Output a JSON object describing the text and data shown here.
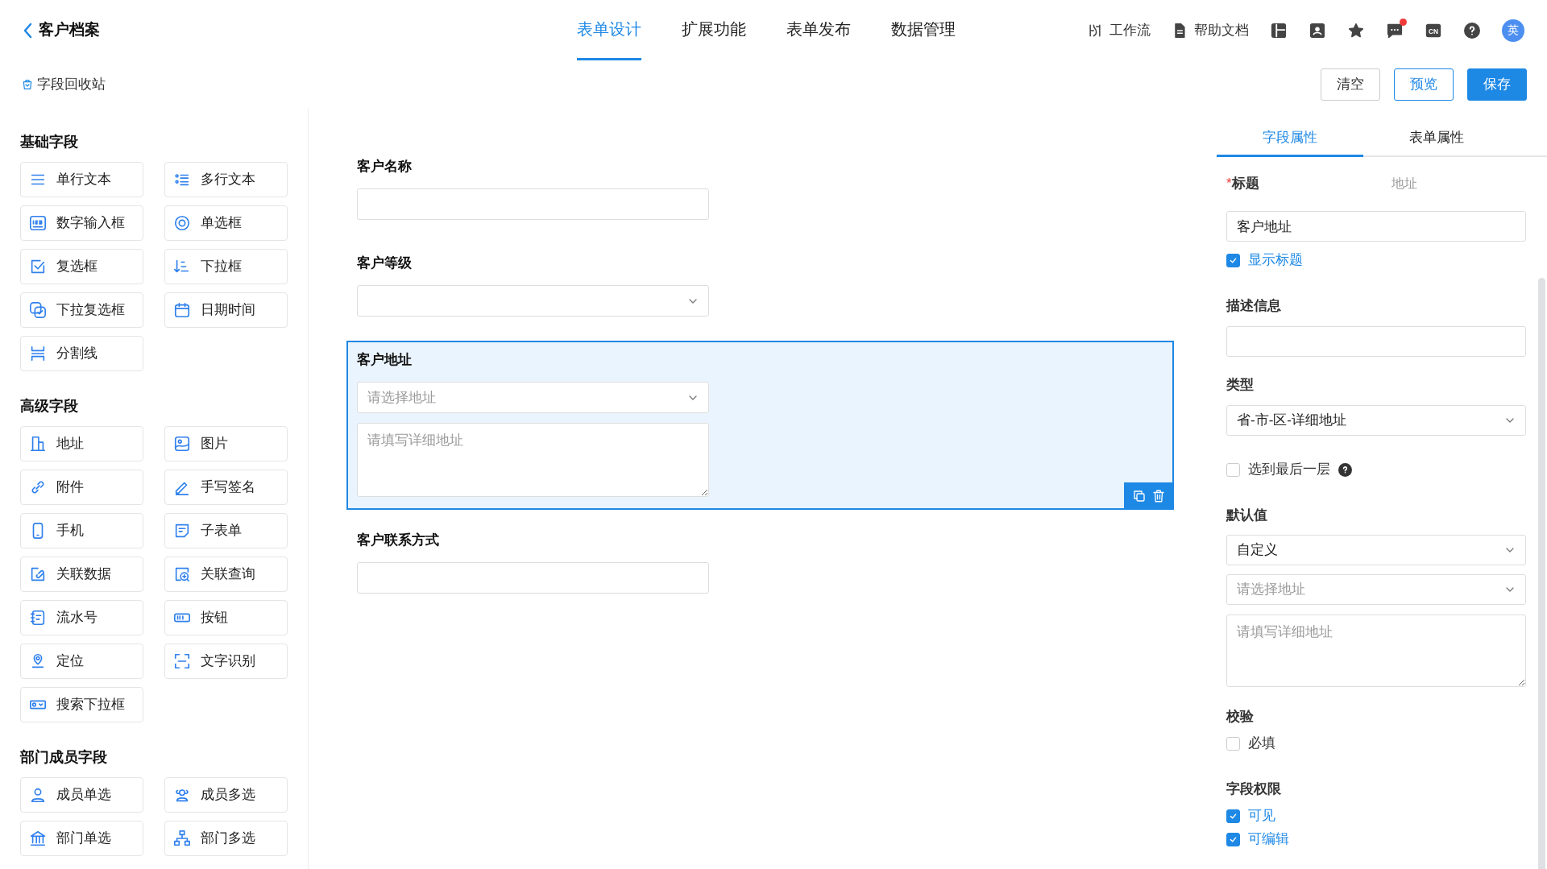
{
  "header": {
    "back_title": "客户档案",
    "tabs": [
      {
        "label": "表单设计",
        "selected": true
      },
      {
        "label": "扩展功能",
        "selected": false
      },
      {
        "label": "表单发布",
        "selected": false
      },
      {
        "label": "数据管理",
        "selected": false
      }
    ],
    "links": [
      "工作流",
      "帮助文档"
    ],
    "language": "CN",
    "chat_unread": true,
    "avatar": "英"
  },
  "subbar": {
    "recycle_link": "字段回收站",
    "buttons": [
      {
        "label": "清空",
        "kind": "secondary"
      },
      {
        "label": "预览",
        "kind": "outline"
      },
      {
        "label": "保存",
        "kind": "primary"
      }
    ]
  },
  "palette": {
    "groups": [
      {
        "title": "基础字段",
        "items": [
          "单行文本",
          "多行文本",
          "数字输入框",
          "单选框",
          "复选框",
          "下拉框",
          "下拉复选框",
          "日期时间",
          "分割线"
        ]
      },
      {
        "title": "高级字段",
        "items": [
          "地址",
          "图片",
          "附件",
          "手写签名",
          "手机",
          "子表单",
          "关联数据",
          "关联查询",
          "流水号",
          "按钮",
          "定位",
          "文字识别",
          "搜索下拉框"
        ]
      },
      {
        "title": "部门成员字段",
        "items": [
          "成员单选",
          "成员多选",
          "部门单选",
          "部门多选"
        ]
      }
    ]
  },
  "canvas": {
    "fields": [
      {
        "kind": "input",
        "label": "客户名称",
        "selected": false
      },
      {
        "kind": "select",
        "label": "客户等级",
        "selected": false
      },
      {
        "kind": "address",
        "label": "客户地址",
        "selected": true,
        "select_placeholder": "请选择地址",
        "detail_placeholder": "请填写详细地址"
      },
      {
        "kind": "input",
        "label": "客户联系方式",
        "selected": false
      }
    ]
  },
  "properties": {
    "tabs": [
      {
        "label": "字段属性",
        "selected": true
      },
      {
        "label": "表单属性",
        "selected": false
      }
    ],
    "title": {
      "required_mark": "*",
      "label": "标题",
      "type_text": "地址",
      "value": "客户地址",
      "show_title": {
        "label": "显示标题",
        "checked": true
      }
    },
    "description": {
      "label": "描述信息"
    },
    "type": {
      "label": "类型",
      "value": "省-市-区-详细地址",
      "last_level": {
        "label": "选到最后一层",
        "checked": false
      }
    },
    "default": {
      "label": "默认值",
      "mode": "自定义",
      "select_placeholder": "请选择地址",
      "detail_placeholder": "请填写详细地址"
    },
    "validation": {
      "label": "校验",
      "options": [
        {
          "label": "必填",
          "checked": false
        }
      ]
    },
    "permissions": {
      "label": "字段权限",
      "options": [
        {
          "label": "可见",
          "checked": true
        },
        {
          "label": "可编辑",
          "checked": true
        }
      ]
    }
  }
}
